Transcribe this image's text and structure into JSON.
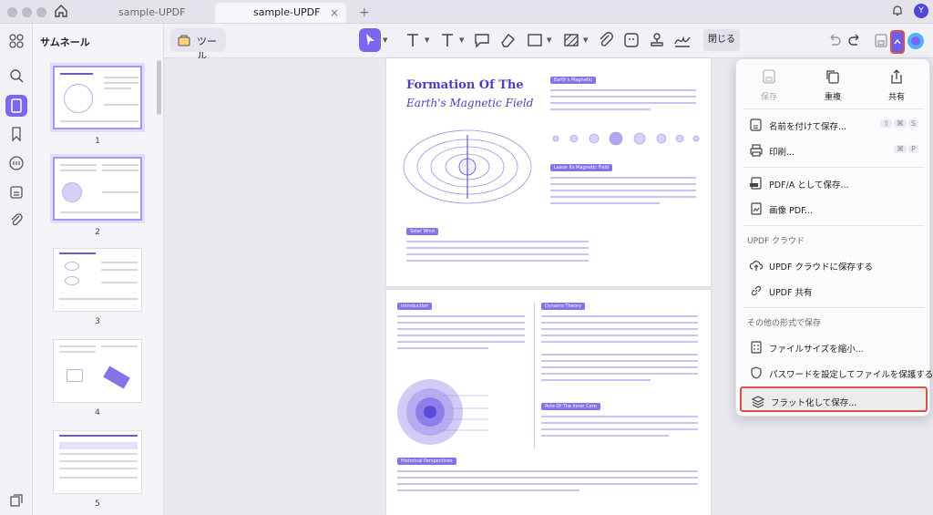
{
  "window": {
    "tabs": [
      {
        "label": "sample-UPDF",
        "active": false
      },
      {
        "label": "sample-UPDF",
        "active": true
      }
    ],
    "new_tab": "+",
    "tab_close": "×",
    "avatar_initial": "Y"
  },
  "sidebar": {
    "title": "サムネール",
    "pages": [
      "1",
      "2",
      "3",
      "4",
      "5"
    ],
    "selected_page": "2"
  },
  "toolbar": {
    "tools_label": "ツール",
    "close_label": "閉じる"
  },
  "document": {
    "page1": {
      "title_line1": "Formation Of The",
      "title_line2": "Earth's Magnetic Field",
      "pill1": "Earth's Magnetic",
      "pill2": "Leave Its Magnetic Field",
      "pill3": "Solar Wind"
    },
    "page2": {
      "pill1": "Introduction",
      "pill2": "Dynamo Theory",
      "pill3": "Role Of The Inner Core",
      "pill4": "Historical Perspectives"
    }
  },
  "menu": {
    "top_actions": [
      {
        "label": "保存",
        "icon": "save-icon",
        "disabled": true
      },
      {
        "label": "重複",
        "icon": "duplicate-icon",
        "disabled": false
      },
      {
        "label": "共有",
        "icon": "share-icon",
        "disabled": false
      }
    ],
    "items": [
      {
        "label": "名前を付けて保存...",
        "icon": "save-as-icon",
        "shortcut": [
          "⇧",
          "⌘",
          "S"
        ]
      },
      {
        "label": "印刷...",
        "icon": "print-icon",
        "shortcut": [
          "⌘",
          "P"
        ]
      },
      {
        "label": "PDF/A として保存...",
        "icon": "pdfa-icon",
        "shortcut": []
      },
      {
        "label": "画像 PDF...",
        "icon": "image-pdf-icon",
        "shortcut": []
      }
    ],
    "cloud_section": "UPDF クラウド",
    "cloud_items": [
      {
        "label": "UPDF クラウドに保存する",
        "icon": "cloud-upload-icon"
      },
      {
        "label": "UPDF 共有",
        "icon": "link-icon"
      }
    ],
    "other_section": "その他の形式で保存",
    "other_items": [
      {
        "label": "ファイルサイズを縮小...",
        "icon": "compress-icon"
      },
      {
        "label": "パスワードを設定してファイルを保護する...",
        "icon": "protect-icon"
      },
      {
        "label": "フラット化して保存...",
        "icon": "flatten-icon"
      }
    ]
  },
  "colors": {
    "accent": "#7b67ee",
    "highlight_border": "#e0504a"
  }
}
